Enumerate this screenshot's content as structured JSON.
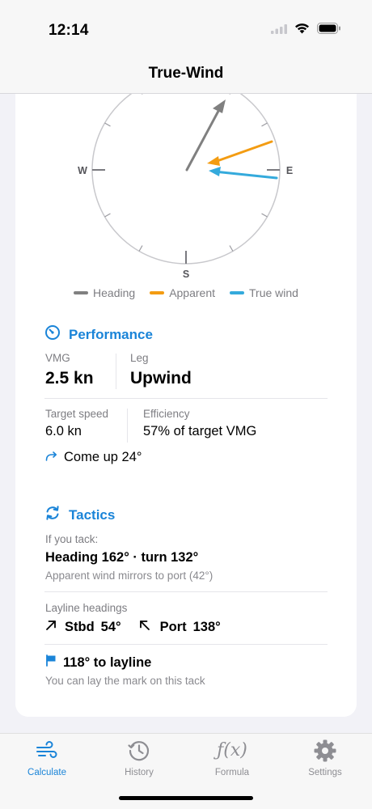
{
  "status": {
    "time": "12:14"
  },
  "nav": {
    "title": "True-Wind"
  },
  "compass": {
    "labels": {
      "west": "W",
      "east": "E",
      "south": "S"
    },
    "colors": {
      "heading": "#808080",
      "apparent": "#f39c12",
      "true_wind": "#34aadc"
    }
  },
  "legend": {
    "heading": "Heading",
    "apparent": "Apparent",
    "true_wind": "True wind"
  },
  "performance": {
    "title": "Performance",
    "vmg_label": "VMG",
    "vmg_value": "2.5 kn",
    "leg_label": "Leg",
    "leg_value": "Upwind",
    "target_speed_label": "Target speed",
    "target_speed_value": "6.0 kn",
    "efficiency_label": "Efficiency",
    "efficiency_value": "57% of target VMG",
    "advice": "Come up 24°"
  },
  "tactics": {
    "title": "Tactics",
    "tack_label": "If you tack:",
    "tack_value": "Heading 162° · turn 132°",
    "tack_note": "Apparent wind mirrors to port (42°)",
    "layline_label": "Layline headings",
    "stbd_label": "Stbd",
    "stbd_value": "54°",
    "port_label": "Port",
    "port_value": "138°",
    "layline_value": "118° to layline",
    "layline_note": "You can lay the mark on this tack"
  },
  "tabs": [
    {
      "label": "Calculate",
      "icon": "wind-icon"
    },
    {
      "label": "History",
      "icon": "clock-history-icon"
    },
    {
      "label": "Formula",
      "icon": "function-icon"
    },
    {
      "label": "Settings",
      "icon": "gear-icon"
    }
  ],
  "accent": "#1a84d8"
}
